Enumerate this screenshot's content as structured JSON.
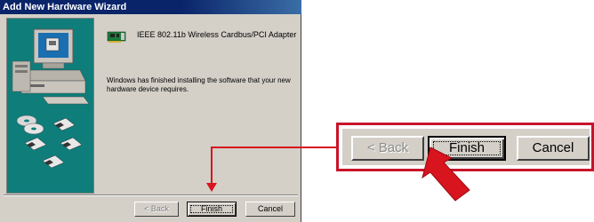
{
  "window": {
    "title": "Add New Hardware Wizard"
  },
  "device": {
    "name": "IEEE 802.11b Wireless Cardbus/PCI Adapter",
    "icon": "network-card-icon"
  },
  "message": "Windows has finished installing the software that your new hardware device requires.",
  "buttons": {
    "back": "< Back",
    "finish": "Finish",
    "cancel": "Cancel"
  },
  "callout": {
    "back": "< Back",
    "finish": "Finish",
    "cancel": "Cancel"
  },
  "colors": {
    "callout_border": "#c8142a",
    "arrow": "#d8141e",
    "dialog_bg": "#d4d0c8",
    "titlebar": "#0a246a"
  }
}
